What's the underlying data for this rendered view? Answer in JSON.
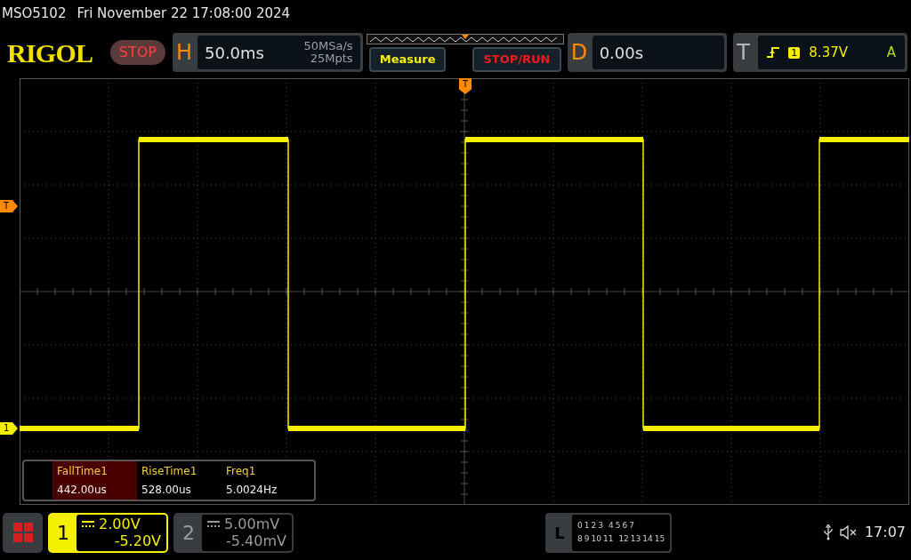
{
  "title_bar": {
    "model": "MSO5102",
    "datetime": "Fri November 22 17:08:00 2024"
  },
  "header": {
    "logo": "RIGOL",
    "run_state": "STOP",
    "horizontal": {
      "label": "H",
      "timebase": "50.0ms",
      "sample_rate": "50MSa/s",
      "memory_depth": "25Mpts"
    },
    "buttons": [
      {
        "label": "Measure",
        "kind": "menu"
      },
      {
        "label": "STOP/RUN",
        "kind": "run"
      }
    ],
    "delay": {
      "label": "D",
      "value": "0.00s"
    },
    "trigger": {
      "label": "T",
      "source": "1",
      "level": "8.37V",
      "mode": "A"
    }
  },
  "graticule": {
    "trigger_position_marker": "T",
    "trigger_level_marker": "T",
    "channel_marker": "1"
  },
  "measurements": [
    {
      "name": "FallTime1",
      "value": "442.00us",
      "selected": true
    },
    {
      "name": "RiseTime1",
      "value": "528.00us",
      "selected": false
    },
    {
      "name": "Freq1",
      "value": "5.0024Hz",
      "selected": false
    }
  ],
  "channels": [
    {
      "number": "1",
      "scale": "2.00V",
      "offset": "-5.20V",
      "enabled": true
    },
    {
      "number": "2",
      "scale": "5.00mV",
      "offset": "-5.40mV",
      "enabled": false
    }
  ],
  "logic": {
    "label": "L",
    "row_1": [
      "0",
      "1",
      "2",
      "3",
      "4",
      "5",
      "6",
      "7"
    ],
    "row_2": [
      "8",
      "9",
      "10",
      "11",
      "12",
      "13",
      "14",
      "15"
    ]
  },
  "status": {
    "time": "17:07"
  }
}
